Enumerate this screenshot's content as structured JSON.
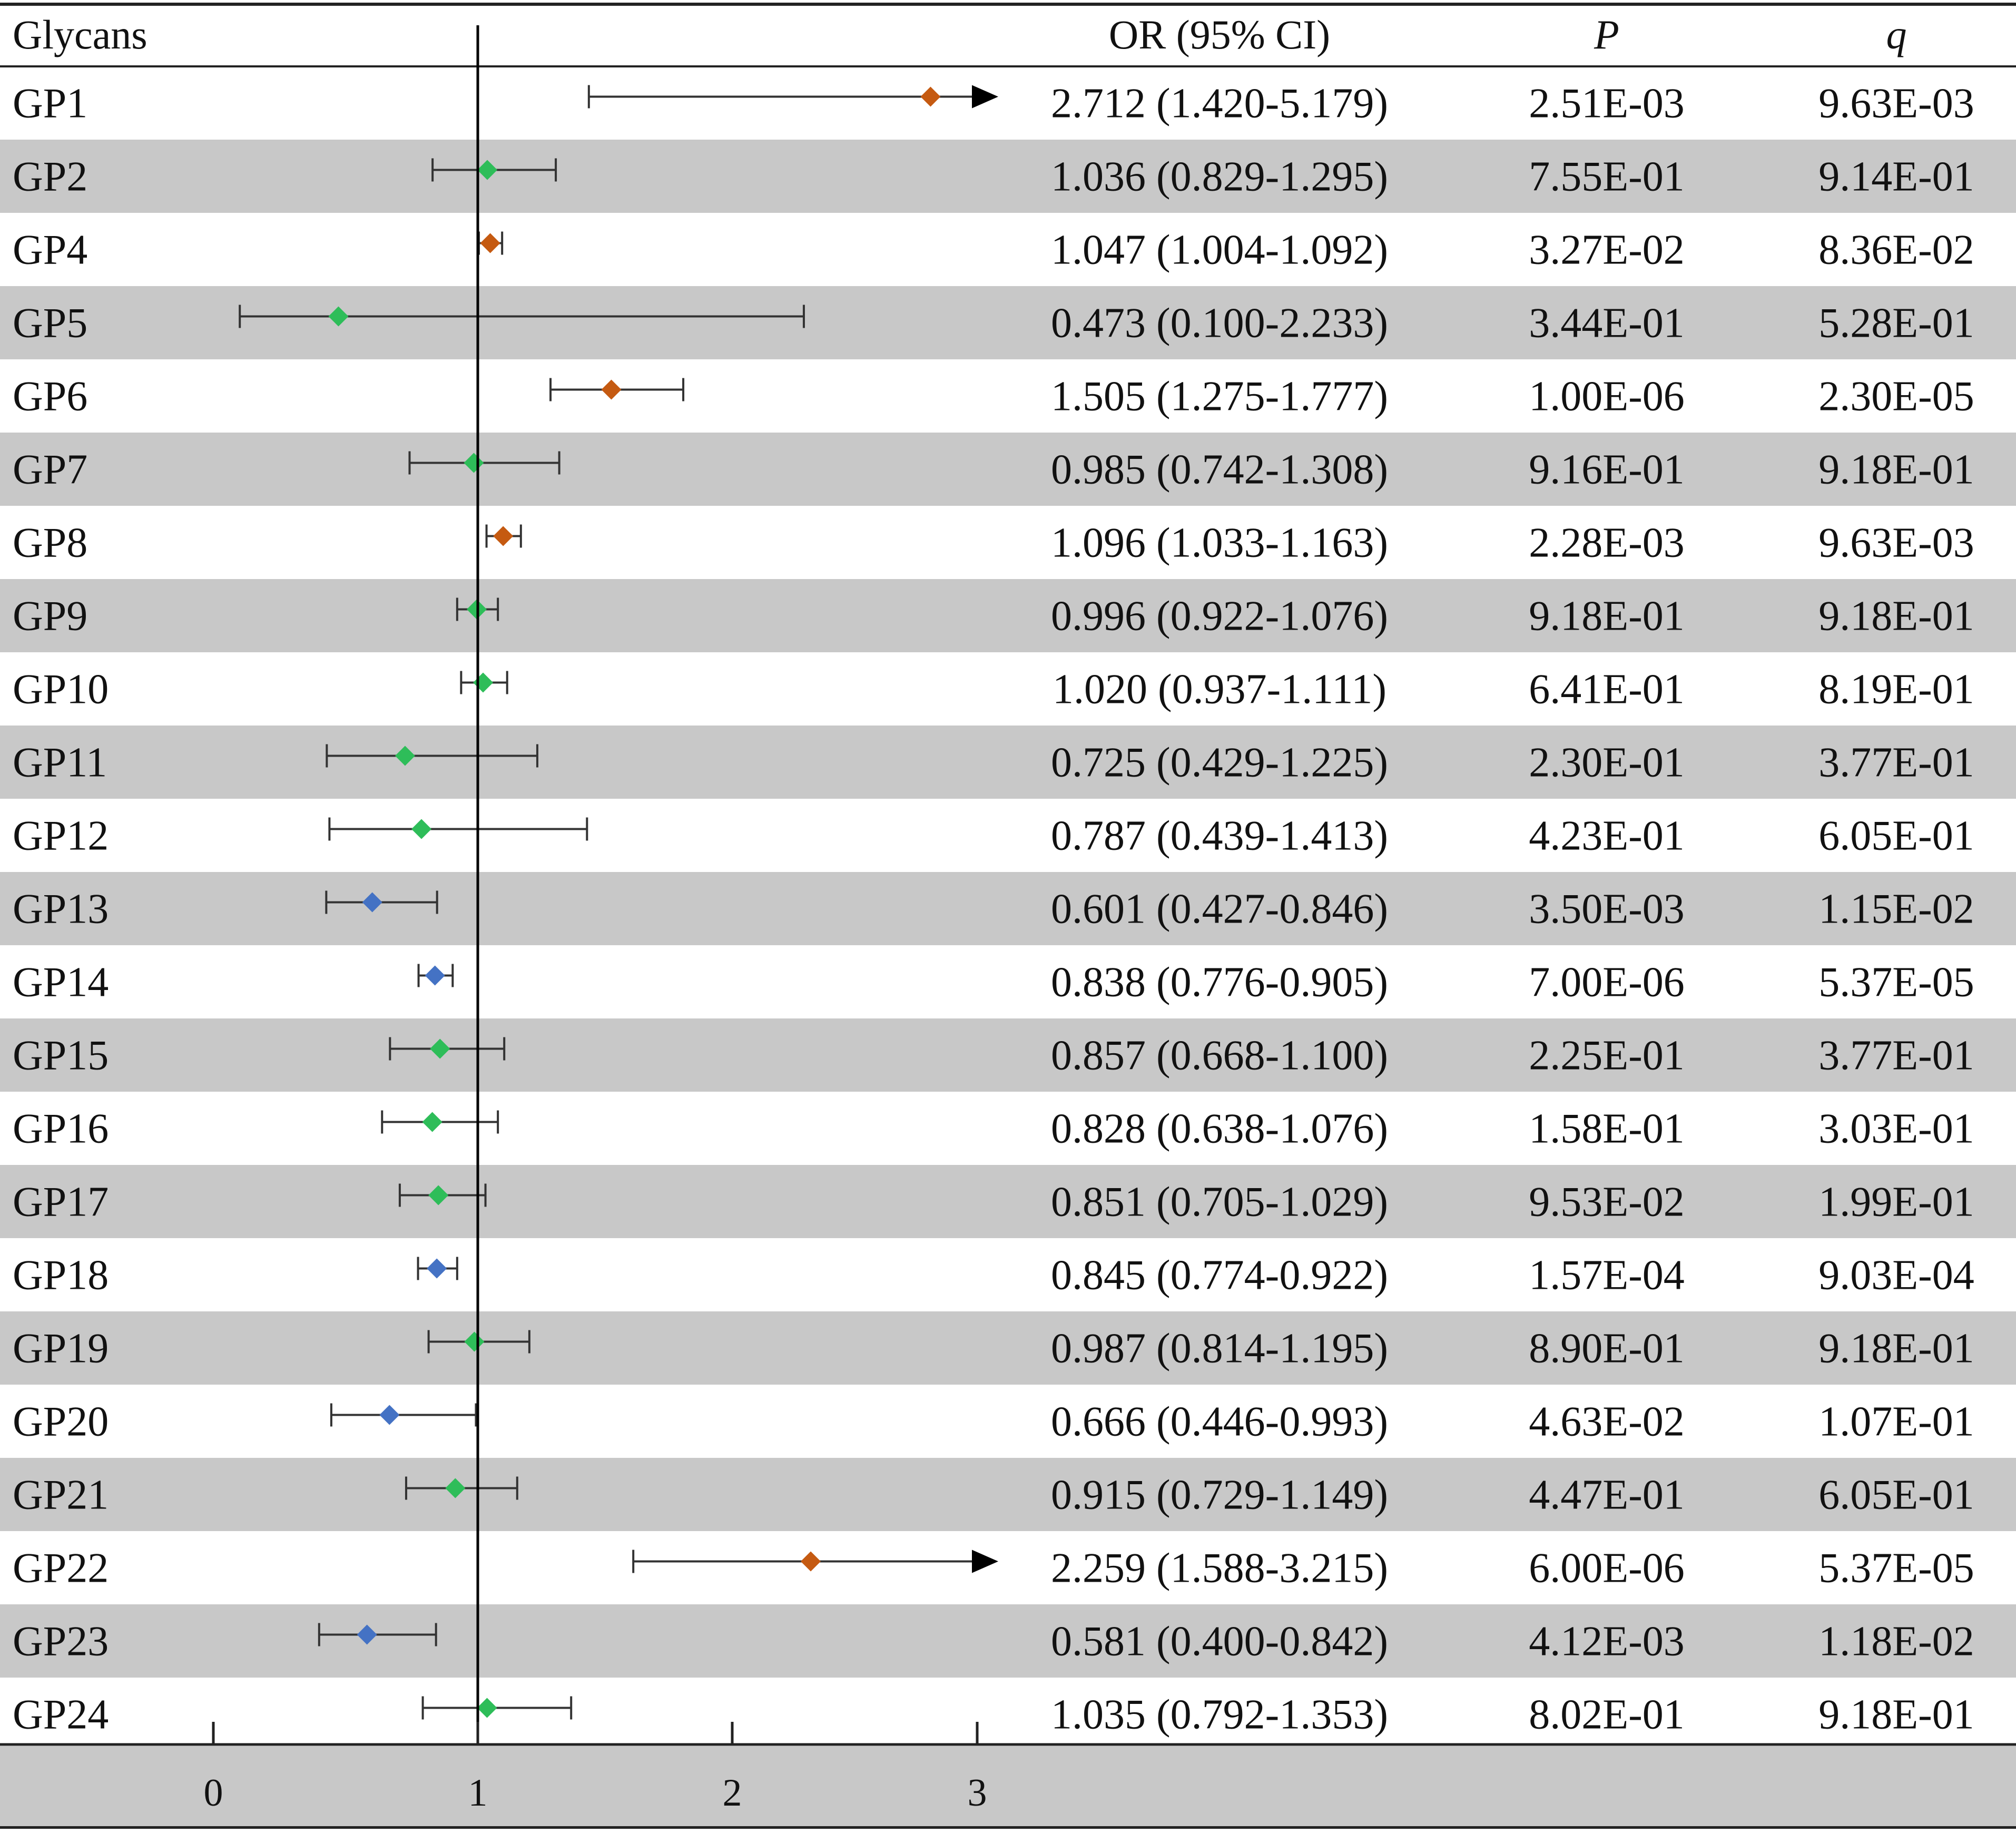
{
  "chart_data": {
    "type": "forest",
    "title": "",
    "columns": {
      "label": "Glycans",
      "or_ci": "OR (95% CI)",
      "p": "P",
      "q": "q"
    },
    "xlim": [
      0,
      3
    ],
    "x_ticks": [
      "0",
      "1",
      "2",
      "3"
    ],
    "reference_line": 1,
    "colors": {
      "significant_positive": "#c55a11",
      "nonsignificant": "#2ebd59",
      "significant_negative": "#4472c4",
      "band": "#c8c8c8"
    },
    "rows": [
      {
        "label": "GP1",
        "or": 2.712,
        "lo": 1.42,
        "hi": 5.179,
        "or_ci": "2.712 (1.420-5.179)",
        "p": "2.51E-03",
        "q": "9.63E-03",
        "group": "significant_positive"
      },
      {
        "label": "GP2",
        "or": 1.036,
        "lo": 0.829,
        "hi": 1.295,
        "or_ci": "1.036 (0.829-1.295)",
        "p": "7.55E-01",
        "q": "9.14E-01",
        "group": "nonsignificant"
      },
      {
        "label": "GP4",
        "or": 1.047,
        "lo": 1.004,
        "hi": 1.092,
        "or_ci": "1.047 (1.004-1.092)",
        "p": "3.27E-02",
        "q": "8.36E-02",
        "group": "significant_positive"
      },
      {
        "label": "GP5",
        "or": 0.473,
        "lo": 0.1,
        "hi": 2.233,
        "or_ci": "0.473 (0.100-2.233)",
        "p": "3.44E-01",
        "q": "5.28E-01",
        "group": "nonsignificant"
      },
      {
        "label": "GP6",
        "or": 1.505,
        "lo": 1.275,
        "hi": 1.777,
        "or_ci": "1.505 (1.275-1.777)",
        "p": "1.00E-06",
        "q": "2.30E-05",
        "group": "significant_positive"
      },
      {
        "label": "GP7",
        "or": 0.985,
        "lo": 0.742,
        "hi": 1.308,
        "or_ci": "0.985 (0.742-1.308)",
        "p": "9.16E-01",
        "q": "9.18E-01",
        "group": "nonsignificant"
      },
      {
        "label": "GP8",
        "or": 1.096,
        "lo": 1.033,
        "hi": 1.163,
        "or_ci": "1.096 (1.033-1.163)",
        "p": "2.28E-03",
        "q": "9.63E-03",
        "group": "significant_positive"
      },
      {
        "label": "GP9",
        "or": 0.996,
        "lo": 0.922,
        "hi": 1.076,
        "or_ci": "0.996 (0.922-1.076)",
        "p": "9.18E-01",
        "q": "9.18E-01",
        "group": "nonsignificant"
      },
      {
        "label": "GP10",
        "or": 1.02,
        "lo": 0.937,
        "hi": 1.111,
        "or_ci": "1.020 (0.937-1.111)",
        "p": "6.41E-01",
        "q": "8.19E-01",
        "group": "nonsignificant"
      },
      {
        "label": "GP11",
        "or": 0.725,
        "lo": 0.429,
        "hi": 1.225,
        "or_ci": "0.725 (0.429-1.225)",
        "p": "2.30E-01",
        "q": "3.77E-01",
        "group": "nonsignificant"
      },
      {
        "label": "GP12",
        "or": 0.787,
        "lo": 0.439,
        "hi": 1.413,
        "or_ci": "0.787 (0.439-1.413)",
        "p": "4.23E-01",
        "q": "6.05E-01",
        "group": "nonsignificant"
      },
      {
        "label": "GP13",
        "or": 0.601,
        "lo": 0.427,
        "hi": 0.846,
        "or_ci": "0.601 (0.427-0.846)",
        "p": "3.50E-03",
        "q": "1.15E-02",
        "group": "significant_negative"
      },
      {
        "label": "GP14",
        "or": 0.838,
        "lo": 0.776,
        "hi": 0.905,
        "or_ci": "0.838 (0.776-0.905)",
        "p": "7.00E-06",
        "q": "5.37E-05",
        "group": "significant_negative"
      },
      {
        "label": "GP15",
        "or": 0.857,
        "lo": 0.668,
        "hi": 1.1,
        "or_ci": "0.857 (0.668-1.100)",
        "p": "2.25E-01",
        "q": "3.77E-01",
        "group": "nonsignificant"
      },
      {
        "label": "GP16",
        "or": 0.828,
        "lo": 0.638,
        "hi": 1.076,
        "or_ci": "0.828 (0.638-1.076)",
        "p": "1.58E-01",
        "q": "3.03E-01",
        "group": "nonsignificant"
      },
      {
        "label": "GP17",
        "or": 0.851,
        "lo": 0.705,
        "hi": 1.029,
        "or_ci": "0.851 (0.705-1.029)",
        "p": "9.53E-02",
        "q": "1.99E-01",
        "group": "nonsignificant"
      },
      {
        "label": "GP18",
        "or": 0.845,
        "lo": 0.774,
        "hi": 0.922,
        "or_ci": "0.845 (0.774-0.922)",
        "p": "1.57E-04",
        "q": "9.03E-04",
        "group": "significant_negative"
      },
      {
        "label": "GP19",
        "or": 0.987,
        "lo": 0.814,
        "hi": 1.195,
        "or_ci": "0.987 (0.814-1.195)",
        "p": "8.90E-01",
        "q": "9.18E-01",
        "group": "nonsignificant"
      },
      {
        "label": "GP20",
        "or": 0.666,
        "lo": 0.446,
        "hi": 0.993,
        "or_ci": "0.666 (0.446-0.993)",
        "p": "4.63E-02",
        "q": "1.07E-01",
        "group": "significant_negative"
      },
      {
        "label": "GP21",
        "or": 0.915,
        "lo": 0.729,
        "hi": 1.149,
        "or_ci": "0.915 (0.729-1.149)",
        "p": "4.47E-01",
        "q": "6.05E-01",
        "group": "nonsignificant"
      },
      {
        "label": "GP22",
        "or": 2.259,
        "lo": 1.588,
        "hi": 3.215,
        "or_ci": "2.259 (1.588-3.215)",
        "p": "6.00E-06",
        "q": "5.37E-05",
        "group": "significant_positive"
      },
      {
        "label": "GP23",
        "or": 0.581,
        "lo": 0.4,
        "hi": 0.842,
        "or_ci": "0.581 (0.400-0.842)",
        "p": "4.12E-03",
        "q": "1.18E-02",
        "group": "significant_negative"
      },
      {
        "label": "GP24",
        "or": 1.035,
        "lo": 0.792,
        "hi": 1.353,
        "or_ci": "1.035 (0.792-1.353)",
        "p": "8.02E-01",
        "q": "9.18E-01",
        "group": "nonsignificant"
      }
    ]
  }
}
